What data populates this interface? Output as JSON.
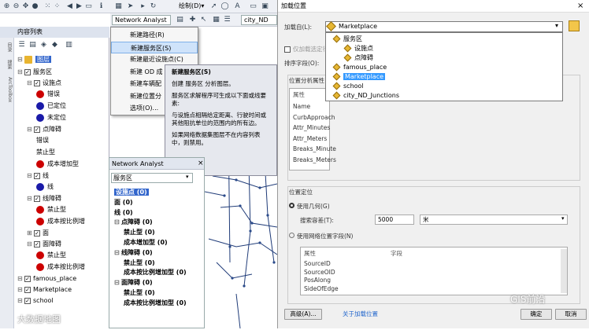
{
  "toolbar": {
    "draw_label": "绘制(D)▾"
  },
  "na_toolbar": {
    "label": "Network Analyst ▾",
    "network_field": "city_ND"
  },
  "na_menu": {
    "items": [
      {
        "label": "新建路径(R)",
        "selected": false
      },
      {
        "label": "新建服务区(S)",
        "selected": true
      },
      {
        "label": "新建最近设施点(C)",
        "selected": false
      },
      {
        "label": "新建 OD 成",
        "selected": false
      },
      {
        "label": "新建车辆配",
        "selected": false
      },
      {
        "label": "新建位置分",
        "selected": false
      },
      {
        "label": "选项(O)...",
        "selected": false
      }
    ]
  },
  "tooltip": {
    "title": "新建服务区(S)",
    "line1": "创建 服务区 分析图层。",
    "line2": "服务区求解程序可生成以下面或线要素:",
    "line3": "与设施点相隔给定距离、行驶时间或其他阻抗单位的范围内的所有边。",
    "line4": "如果网络数据集图层不在内容列表中，则禁用。"
  },
  "toc": {
    "title": "内容列表",
    "side_tabs": [
      "目录",
      "搜索",
      "ArcToolbox"
    ],
    "layers_label": "图层",
    "rows": [
      {
        "label": "服务区",
        "indent": 1,
        "check": true,
        "expander": "⊟"
      },
      {
        "label": "设施点",
        "indent": 2,
        "check": true,
        "expander": "⊟"
      },
      {
        "label": "错误",
        "indent": 3,
        "symbol": "#cc0000"
      },
      {
        "label": "已定位",
        "indent": 3,
        "symbol": "#1a1aa8"
      },
      {
        "label": "未定位",
        "indent": 3,
        "symbol": "#1a1aa8"
      },
      {
        "label": "点障碍",
        "indent": 2,
        "check": true,
        "expander": "⊟"
      },
      {
        "label": "错误",
        "indent": 3
      },
      {
        "label": "禁止型",
        "indent": 3
      },
      {
        "label": "成本增加型",
        "indent": 3,
        "symbol": "#cc0000"
      },
      {
        "label": "线",
        "indent": 2,
        "check": true,
        "expander": "⊟"
      },
      {
        "label": "线",
        "indent": 3,
        "symbol": "#1a1aa8"
      },
      {
        "label": "线障碍",
        "indent": 2,
        "check": true,
        "expander": "⊟"
      },
      {
        "label": "禁止型",
        "indent": 3,
        "symbol": "#cc0000"
      },
      {
        "label": "成本按比例增",
        "indent": 3,
        "symbol": "#cc0000"
      },
      {
        "label": "面",
        "indent": 2,
        "check": true,
        "expander": "⊞"
      },
      {
        "label": "面障碍",
        "indent": 2,
        "check": true,
        "expander": "⊟"
      },
      {
        "label": "禁止型",
        "indent": 3,
        "symbol": "#cc0000"
      },
      {
        "label": "成本按比例增",
        "indent": 3,
        "symbol": "#cc0000"
      },
      {
        "label": "famous_place",
        "indent": 1,
        "check": true,
        "expander": "⊟"
      },
      {
        "label": "Marketplace",
        "indent": 1,
        "check": true,
        "expander": "⊟"
      },
      {
        "label": "school",
        "indent": 1,
        "check": true,
        "expander": "⊟"
      }
    ]
  },
  "na_window": {
    "title": "Network Analyst",
    "combo": "服务区",
    "items": [
      {
        "label": "设施点 (0)",
        "indent": 0,
        "highlight": true
      },
      {
        "label": "面 (0)",
        "indent": 0
      },
      {
        "label": "线 (0)",
        "indent": 0
      },
      {
        "label": "点障碍 (0)",
        "indent": 0,
        "expander": "⊟"
      },
      {
        "label": "禁止型 (0)",
        "indent": 1
      },
      {
        "label": "成本增加型 (0)",
        "indent": 1
      },
      {
        "label": "线障碍 (0)",
        "indent": 0,
        "expander": "⊟"
      },
      {
        "label": "禁止型 (0)",
        "indent": 1
      },
      {
        "label": "成本按比例增加型 (0)",
        "indent": 1
      },
      {
        "label": "面障碍 (0)",
        "indent": 0,
        "expander": "⊟"
      },
      {
        "label": "禁止型 (0)",
        "indent": 1
      },
      {
        "label": "成本按比例增加型 (0)",
        "indent": 1
      }
    ]
  },
  "dialog": {
    "title": "加载位置",
    "load_from_label": "加载自(L):",
    "load_from_value": "Marketplace",
    "only_selected": "仅加载选定行",
    "sort_field": "排序字段(O):",
    "location_props": "位置分析属性",
    "props_col": "属性",
    "props_rows": [
      "Name",
      "CurbApproach",
      "Attr_Minutes",
      "Attr_Meters",
      "Breaks_Minute",
      "Breaks_Meters"
    ],
    "dropdown_items": [
      {
        "label": "服务区",
        "indent": 1
      },
      {
        "label": "设施点",
        "indent": 2
      },
      {
        "label": "点障碍",
        "indent": 2
      },
      {
        "label": "famous_place",
        "indent": 1
      },
      {
        "label": "Marketplace",
        "indent": 1,
        "selected": true
      },
      {
        "label": "school",
        "indent": 1
      },
      {
        "label": "city_ND_Junctions",
        "indent": 1
      }
    ],
    "position_section": "位置定位",
    "use_geometry": "使用几何(G)",
    "tolerance_label": "搜索容差(T):",
    "tolerance_value": "5000",
    "tolerance_unit": "米",
    "use_network_fields": "使用网络位置字段(N)",
    "nf_col1": "属性",
    "nf_col2": "字段",
    "nf_rows": [
      "SourceID",
      "SourceOID",
      "PosAlong",
      "SideOfEdge"
    ],
    "advanced_btn": "高级(A)...",
    "about_link": "关于加载位置",
    "ok_btn": "确定",
    "cancel_btn": "取消"
  },
  "watermarks": {
    "right": "GIS前沿",
    "left": "大数据地图"
  }
}
